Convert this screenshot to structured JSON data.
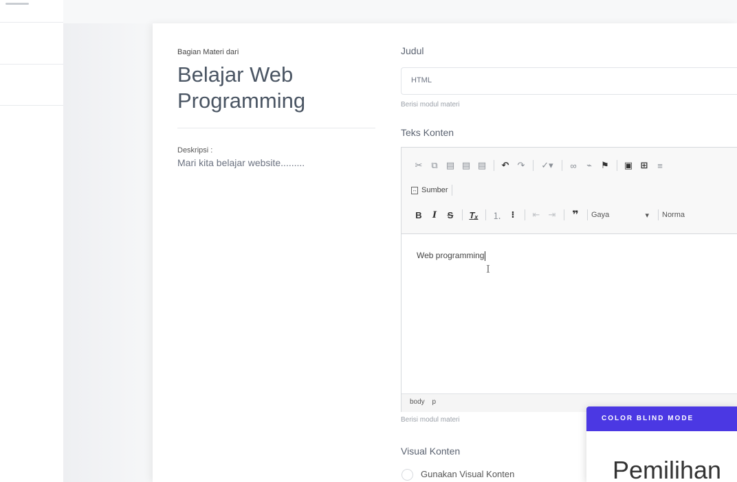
{
  "material": {
    "section_label": "Bagian Materi dari",
    "course_title": "Belajar Web Programming",
    "description_label": "Deskripsi :",
    "description": "Mari kita belajar website........."
  },
  "form": {
    "title_label": "Judul",
    "title_value": "HTML",
    "title_help": "Berisi modul materi",
    "content_label": "Teks Konten",
    "content_help": "Berisi modul materi",
    "visual_label": "Visual Konten",
    "visual_option": "Gunakan Visual Konten"
  },
  "editor": {
    "source_label": "Sumber",
    "style_combo": "Gaya",
    "format_combo": "Norma",
    "content_text": "Web programming",
    "path": [
      "body",
      "p"
    ]
  },
  "color_blind": {
    "header": "COLOR BLIND MODE",
    "title": "Pemilihan"
  },
  "colors": {
    "accent": "#4b38e3"
  }
}
